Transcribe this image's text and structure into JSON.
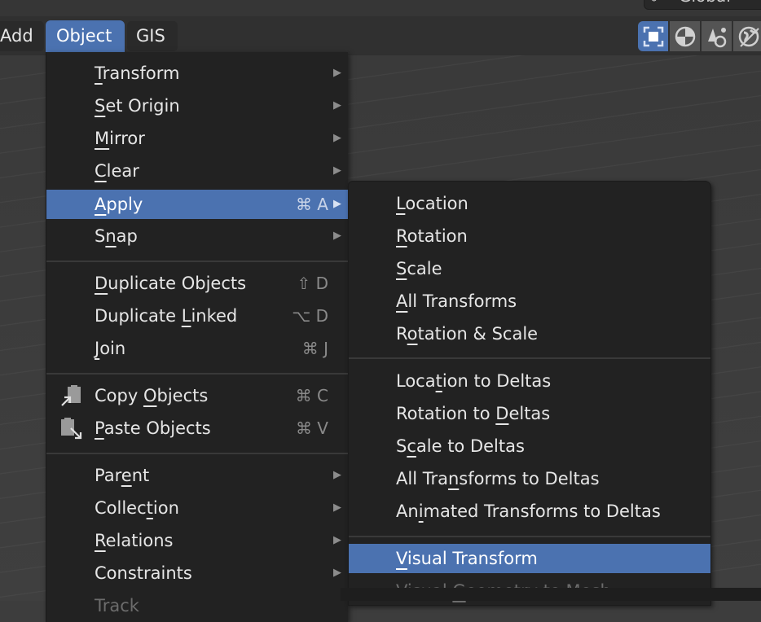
{
  "header": {
    "menus": [
      {
        "label": "Add"
      },
      {
        "label": "Object",
        "active": true
      },
      {
        "label": "GIS"
      }
    ],
    "orientation": {
      "icon": "transform-orientation-icon",
      "label": "Global"
    },
    "shading_modes": [
      {
        "name": "wireframe",
        "icon": "wireframe-shading-icon",
        "active": true
      },
      {
        "name": "solid",
        "icon": "solid-shading-icon",
        "active": false
      },
      {
        "name": "material",
        "icon": "material-preview-icon",
        "active": false
      },
      {
        "name": "rendered",
        "icon": "rendered-shading-icon",
        "active": false
      }
    ]
  },
  "object_menu": {
    "items": [
      {
        "pre": "",
        "u": "T",
        "post": "ransform",
        "shortcut": "",
        "submenu": true
      },
      {
        "pre": "",
        "u": "S",
        "post": "et Origin",
        "shortcut": "",
        "submenu": true
      },
      {
        "pre": "",
        "u": "M",
        "post": "irror",
        "shortcut": "",
        "submenu": true
      },
      {
        "pre": "",
        "u": "C",
        "post": "lear",
        "shortcut": "",
        "submenu": true
      },
      {
        "pre": "",
        "u": "A",
        "post": "pply",
        "shortcut": "⌘ A",
        "submenu": true,
        "highlighted": true
      },
      {
        "pre": "S",
        "u": "n",
        "post": "ap",
        "shortcut": "",
        "submenu": true
      },
      {
        "pre": "",
        "u": "D",
        "post": "uplicate Objects",
        "shortcut": "⇧ D"
      },
      {
        "pre": "Duplicate ",
        "u": "L",
        "post": "inked",
        "shortcut": "⌥ D"
      },
      {
        "pre": "",
        "u": "J",
        "post": "oin",
        "shortcut": "⌘ J"
      },
      {
        "pre": "Copy ",
        "u": "O",
        "post": "bjects",
        "shortcut": "⌘ C",
        "icon": "copy-objects-icon"
      },
      {
        "pre": "",
        "u": "P",
        "post": "aste Objects",
        "shortcut": "⌘ V",
        "icon": "paste-objects-icon"
      },
      {
        "pre": "Par",
        "u": "e",
        "post": "nt",
        "submenu": true
      },
      {
        "pre": "Collec",
        "u": "t",
        "post": "ion",
        "submenu": true
      },
      {
        "pre": "",
        "u": "R",
        "post": "elations",
        "submenu": true
      },
      {
        "pre": "Constraints",
        "u": "",
        "post": "",
        "submenu": true
      },
      {
        "pre": "Track",
        "u": "",
        "post": "",
        "partial": true
      }
    ]
  },
  "apply_submenu": {
    "items": [
      {
        "pre": "",
        "u": "L",
        "post": "ocation"
      },
      {
        "pre": "",
        "u": "R",
        "post": "otation"
      },
      {
        "pre": "",
        "u": "S",
        "post": "cale"
      },
      {
        "pre": "",
        "u": "A",
        "post": "ll Transforms"
      },
      {
        "pre": "R",
        "u": "o",
        "post": "tation & Scale"
      },
      {
        "pre": "Loca",
        "u": "t",
        "post": "ion to Deltas"
      },
      {
        "pre": "Rotation to ",
        "u": "D",
        "post": "eltas"
      },
      {
        "pre": "S",
        "u": "c",
        "post": "ale to Deltas"
      },
      {
        "pre": "All Tra",
        "u": "n",
        "post": "sforms to Deltas"
      },
      {
        "pre": "An",
        "u": "i",
        "post": "mated Transforms to Deltas"
      },
      {
        "pre": "",
        "u": "V",
        "post": "isual Transform",
        "highlighted": true
      },
      {
        "pre": "Visual ",
        "u": "G",
        "post": "eometry to Mesh",
        "partial": true
      }
    ]
  },
  "arrow_glyph": "▶",
  "colors": {
    "accent": "#4b72b0",
    "menu_bg": "#222222",
    "header_bg": "#303030"
  }
}
